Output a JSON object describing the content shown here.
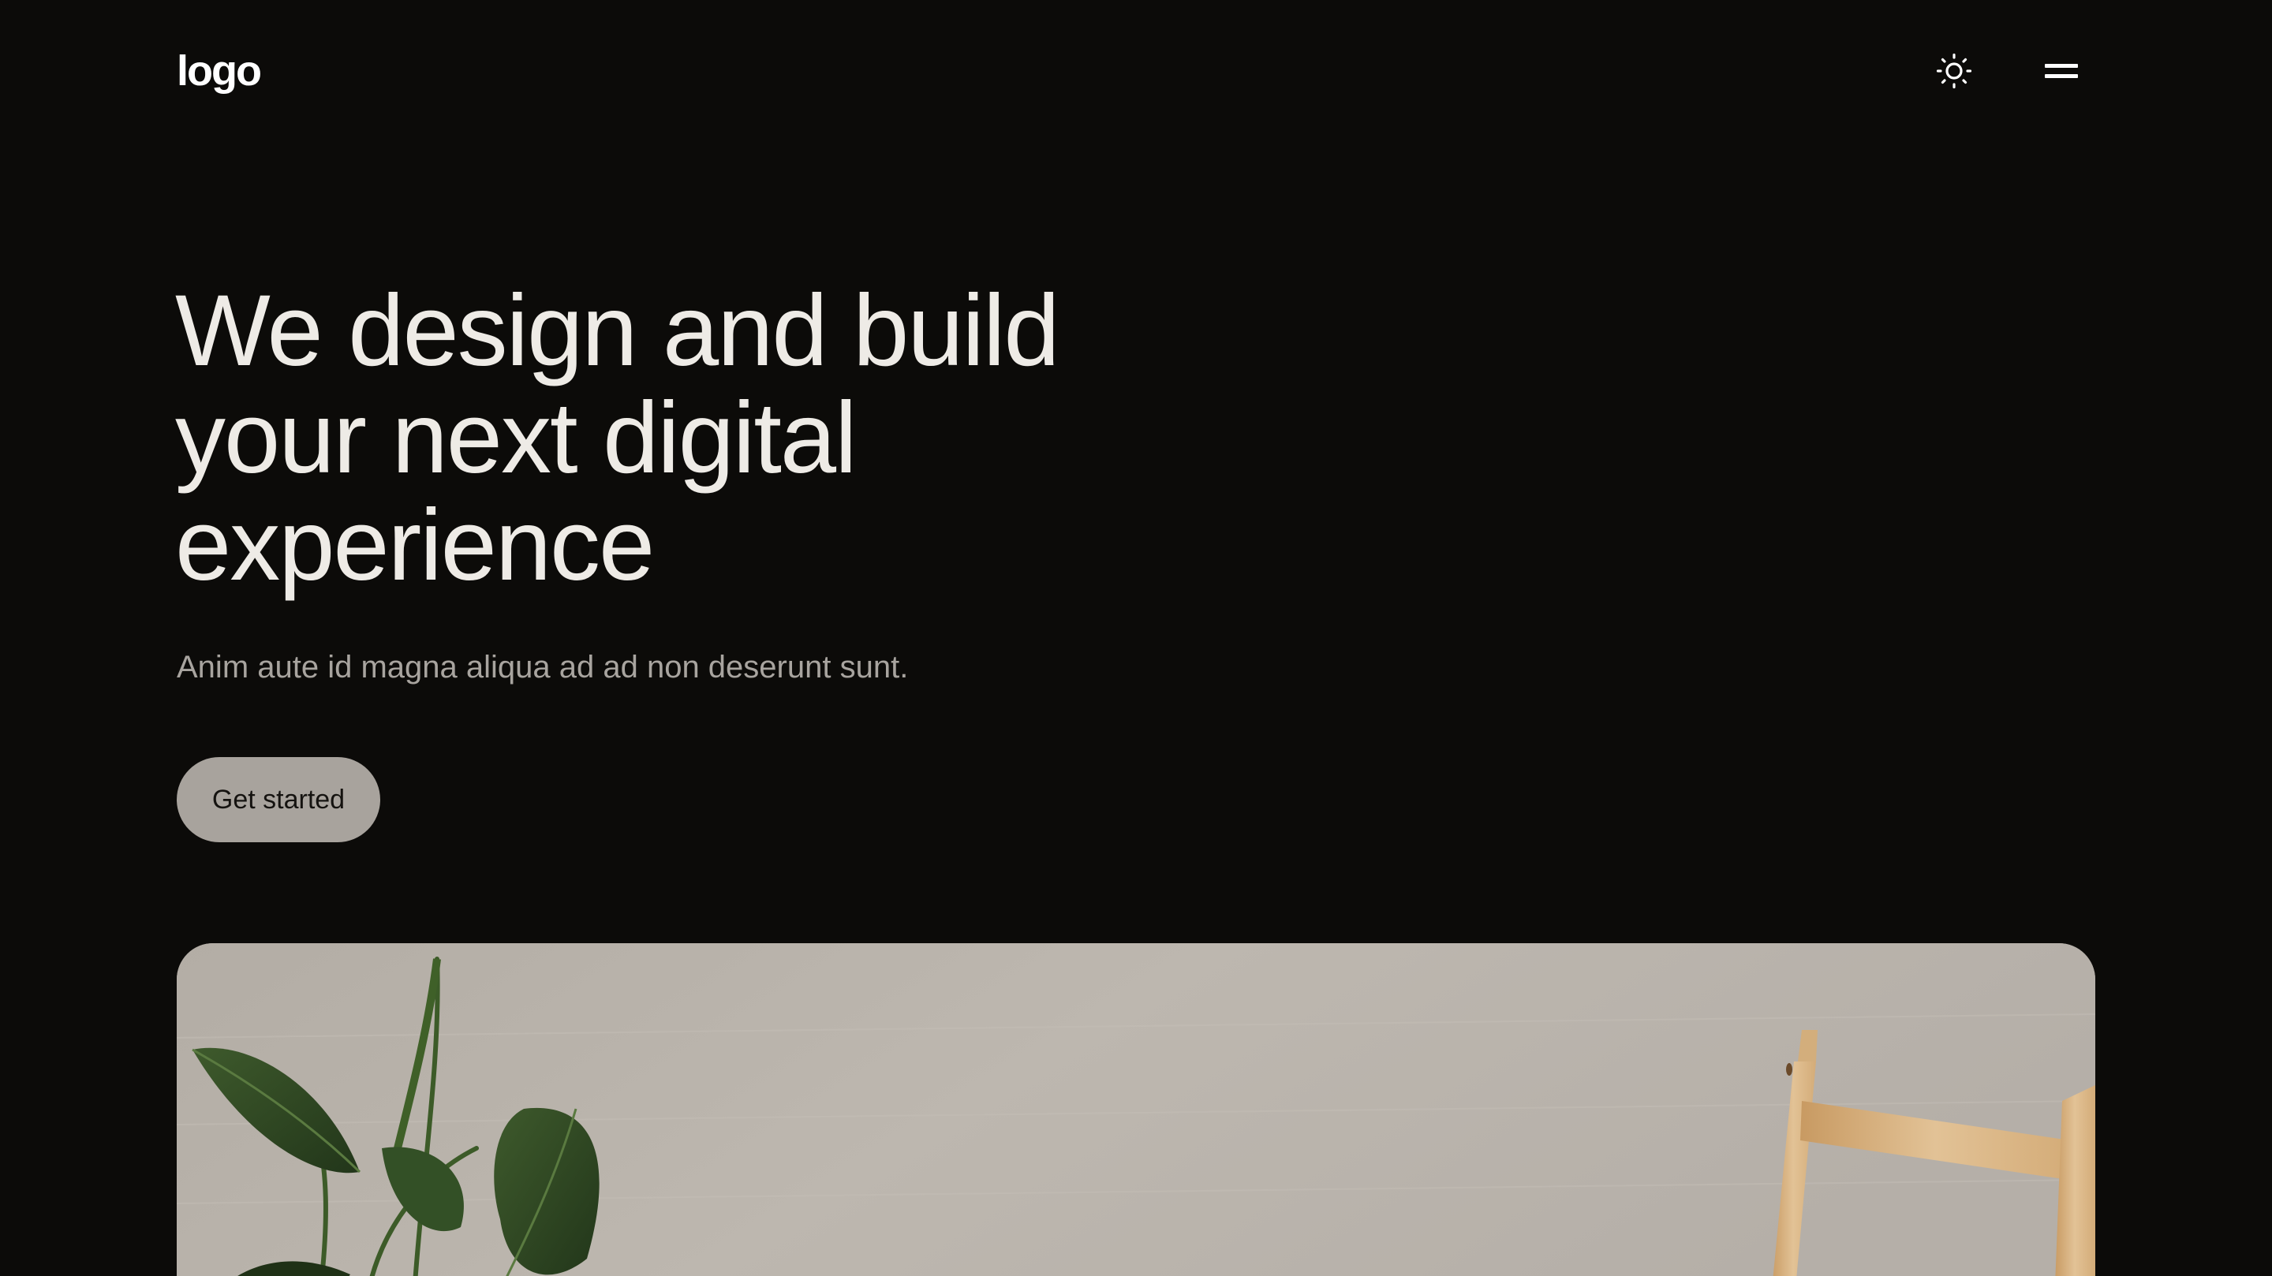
{
  "header": {
    "logo_text": "logo",
    "theme_toggle_icon": "sun-icon",
    "menu_icon": "menu-icon"
  },
  "hero": {
    "title_lines": [
      "We design and build",
      "your next digital",
      "experience"
    ],
    "subtitle": "Anim aute id magna aliqua ad ad non deserunt sunt.",
    "cta_label": "Get started"
  },
  "image": {
    "description_icon": "hero-photo"
  },
  "colors": {
    "background": "#0c0b09",
    "title": "#eeebe6",
    "subtitle": "#a8a49f",
    "cta_background": "#a8a39d",
    "cta_text": "#151310"
  }
}
